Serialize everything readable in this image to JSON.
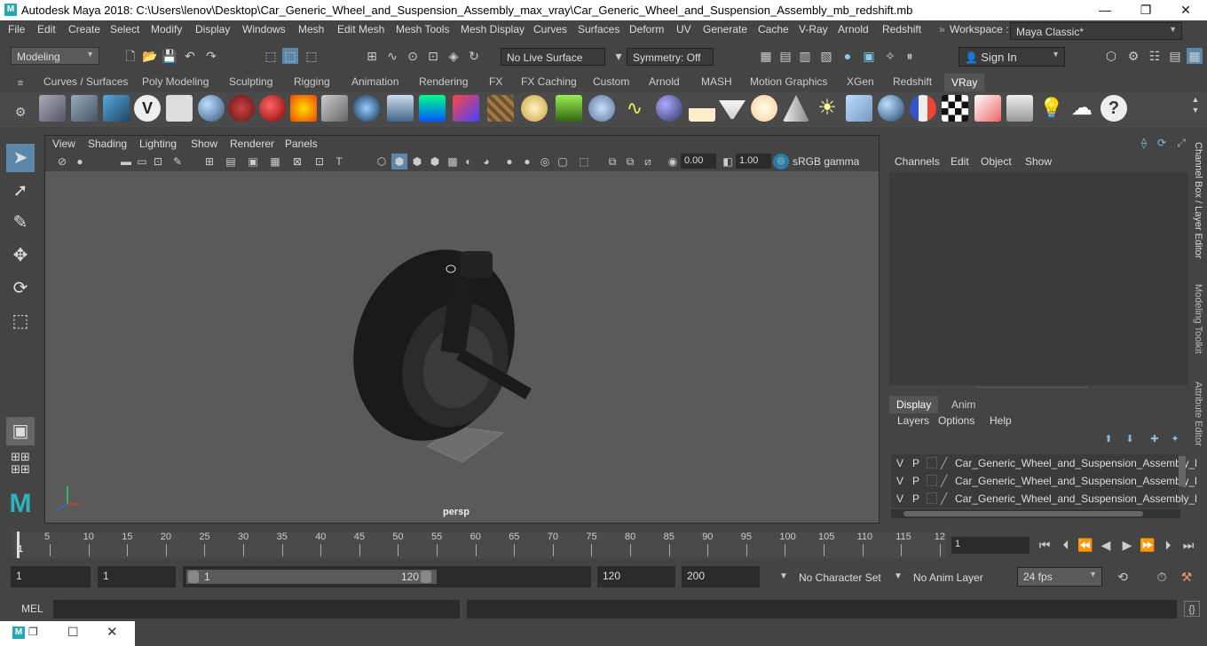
{
  "app": {
    "title": "Autodesk Maya 2018: C:\\Users\\lenov\\Desktop\\Car_Generic_Wheel_and_Suspension_Assembly_max_vray\\Car_Generic_Wheel_and_Suspension_Assembly_mb_redshift.mb",
    "logo_letter": "M"
  },
  "window_controls": {
    "minimize": "—",
    "maximize": "❐",
    "close": "✕"
  },
  "menubar": {
    "items": [
      "File",
      "Edit",
      "Create",
      "Select",
      "Modify",
      "Display",
      "Windows",
      "Mesh",
      "Edit Mesh",
      "Mesh Tools",
      "Mesh Display",
      "Curves",
      "Surfaces",
      "Deform",
      "UV",
      "Generate",
      "Cache",
      "V-Ray",
      "Arnold",
      "Redshift"
    ],
    "workspace_label": "Workspace :",
    "workspace_value": "Maya Classic*"
  },
  "statusline": {
    "mode": "Modeling",
    "live_surface": "No Live Surface",
    "symmetry": "Symmetry: Off",
    "sign_in": "Sign In"
  },
  "shelf": {
    "tabs": [
      "Curves / Surfaces",
      "Poly Modeling",
      "Sculpting",
      "Rigging",
      "Animation",
      "Rendering",
      "FX",
      "FX Caching",
      "Custom",
      "Arnold",
      "MASH",
      "Motion Graphics",
      "XGen",
      "Redshift",
      "VRay"
    ],
    "active_tab": "VRay"
  },
  "viewport": {
    "menu": [
      "View",
      "Shading",
      "Lighting",
      "Show",
      "Renderer",
      "Panels"
    ],
    "exposure": "0.00",
    "gamma": "1.00",
    "color_space": "sRGB gamma",
    "camera_label": "persp"
  },
  "channelbox": {
    "menu": [
      "Channels",
      "Edit",
      "Object",
      "Show"
    ],
    "side_tabs": [
      "Channel Box / Layer Editor",
      "Modeling Toolkit",
      "Attribute Editor"
    ]
  },
  "layers": {
    "tabs": [
      "Display",
      "Anim"
    ],
    "active_tab": "Display",
    "menu": [
      "Layers",
      "Options",
      "Help"
    ],
    "rows": [
      {
        "v": "V",
        "p": "P",
        "name": "Car_Generic_Wheel_and_Suspension_Assembly_l"
      },
      {
        "v": "V",
        "p": "P",
        "name": "Car_Generic_Wheel_and_Suspension_Assembly_l"
      },
      {
        "v": "V",
        "p": "P",
        "name": "Car_Generic_Wheel_and_Suspension_Assembly_l"
      }
    ]
  },
  "timeline": {
    "ticks": [
      "5",
      "10",
      "15",
      "20",
      "25",
      "30",
      "35",
      "40",
      "45",
      "50",
      "55",
      "60",
      "65",
      "70",
      "75",
      "80",
      "85",
      "90",
      "95",
      "100",
      "105",
      "110",
      "115",
      "12"
    ],
    "current_frame_marker": "1",
    "current_frame": "1"
  },
  "range": {
    "start": "1",
    "playback_start": "1",
    "slider_start": "1",
    "slider_end": "120",
    "playback_end": "120",
    "end": "200",
    "character_set": "No Character Set",
    "anim_layer": "No Anim Layer",
    "fps": "24 fps"
  },
  "cmdline": {
    "label": "MEL"
  }
}
